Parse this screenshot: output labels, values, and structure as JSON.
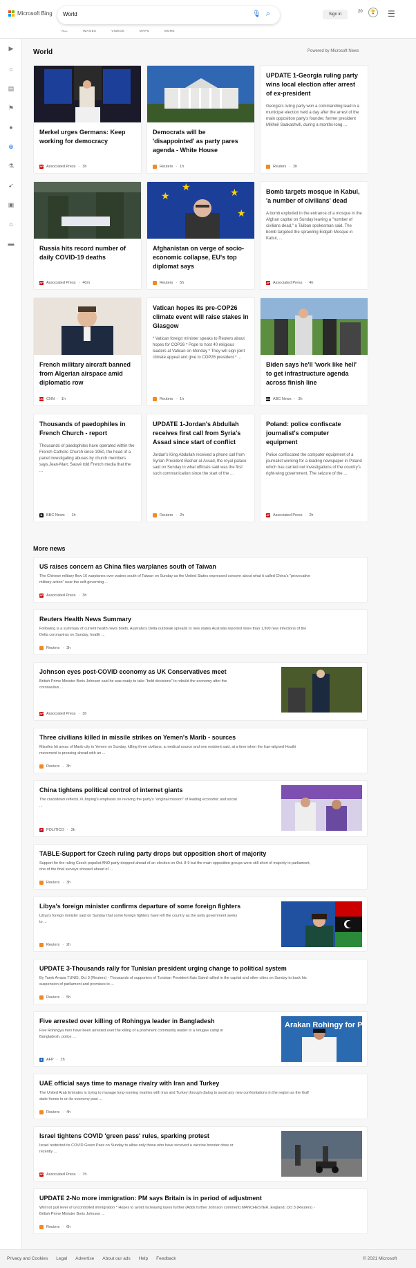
{
  "brand": "Microsoft Bing",
  "search": {
    "value": "World"
  },
  "nav": [
    "ALL",
    "IMAGES",
    "VIDEOS",
    "MAPS",
    "MORE"
  ],
  "header": {
    "signin": "Sign in",
    "rewards_count": "20"
  },
  "section": {
    "title": "World",
    "powered": "Powered by Microsoft News"
  },
  "cards": [
    {
      "title": "Merkel urges Germans: Keep working for democracy",
      "snippet": "",
      "source": "Associated Press",
      "time": "3h",
      "logo": "AP"
    },
    {
      "title": "Democrats will be 'disappointed' as party pares agenda - White House",
      "snippet": "",
      "source": "Reuters",
      "time": "1h",
      "logo": "R"
    },
    {
      "title": "UPDATE 1-Georgia ruling party wins local election after arrest of ex-president",
      "snippet": "Georgia's ruling party won a commanding lead in a municipal election held a day after the arrest of the main opposition party's founder, former president Mikheil Saakashvili, during a months-long ...",
      "source": "Reuters",
      "time": "2h",
      "logo": "R"
    },
    {
      "title": "Russia hits record number of daily COVID-19 deaths",
      "snippet": "",
      "source": "Associated Press",
      "time": "40m",
      "logo": "AP"
    },
    {
      "title": "Afghanistan on verge of socio-economic collapse, EU's top diplomat says",
      "snippet": "",
      "source": "Reuters",
      "time": "5h",
      "logo": "R"
    },
    {
      "title": "Bomb targets mosque in Kabul, 'a number of civilians' dead",
      "snippet": "A bomb exploded in the entrance of a mosque in the Afghan capital on Sunday leaving a \"number of civilians dead,\" a Taliban spokesman said. The bomb targeted the sprawling Eidgah Mosque in Kabul, ...",
      "source": "Associated Press",
      "time": "4h",
      "logo": "AP"
    },
    {
      "title": "French military aircraft banned from Algerian airspace amid diplomatic row",
      "snippet": "",
      "source": "CNN",
      "time": "1h",
      "logo": "CNN"
    },
    {
      "title": "Vatican hopes its pre-COP26 climate event will raise stakes in Glasgow",
      "snippet": "* Vatican foreign minister speaks to Reuters about hopes for COP26 * Pope to host 40 religious leaders at Vatican on Monday * They will sign joint climate appeal and give to COP26 president * ...",
      "source": "Reuters",
      "time": "1h",
      "logo": "R"
    },
    {
      "title": "Biden says he'll 'work like hell' to get infrastructure agenda across finish line",
      "snippet": "",
      "source": "ABC News",
      "time": "3h",
      "logo": "abc"
    },
    {
      "title": "Thousands of paedophiles in French Church - report",
      "snippet": "Thousands of paedophiles have operated within the French Catholic Church since 1950, the head of a panel investigating abuses by church members says.Jean-Marc Sauvé told French media that the ...",
      "source": "BBC News",
      "time": "1h",
      "logo": "BBC"
    },
    {
      "title": "UPDATE 1-Jordan's Abdullah receives first call from Syria's Assad since start of conflict",
      "snippet": "Jordan's King Abdullah received a phone call from Syrian President Bashar al-Assad, the royal palace said on Sunday in what officials said was the first such communication since the start of the ...",
      "source": "Reuters",
      "time": "2h",
      "logo": "R"
    },
    {
      "title": "Poland: police confiscate journalist's computer equipment",
      "snippet": "Police confiscated the computer equipment of a journalist working for a leading newspaper in Poland which has carried out investigations of the country's right-wing government. The seizure of the ...",
      "source": "Associated Press",
      "time": "2h",
      "logo": "AP"
    }
  ],
  "more_news": {
    "title": "More news",
    "items": [
      {
        "title": "US raises concern as China flies warplanes south of Taiwan",
        "snippet1": "The Chinese military flew 16 warplanes over waters south of Taiwan on Sunday as the United States expressed concern about what it called China's \"provocative",
        "snippet2": "military action\" near the self-governing ...",
        "source": "Associated Press",
        "time": "3h",
        "logo": "AP"
      },
      {
        "title": "Reuters Health News Summary",
        "snippet1": "Following is a summary of current health news briefs. Australia's Delta outbreak spreads to new states Australia reported more than 1,900 new infections of the",
        "snippet2": "Delta coronavirus on Sunday, health ...",
        "source": "Reuters",
        "time": "3h",
        "logo": "R"
      },
      {
        "title": "Johnson eyes post-COVID economy as UK Conservatives meet",
        "snippet1": "British Prime Minister Boris Johnson said he was ready to take \"bold decisions\" to rebuild the economy after the",
        "snippet2": "coronavirus ...",
        "source": "Associated Press",
        "time": "3h",
        "logo": "AP"
      },
      {
        "title": "Three civilians killed in missile strikes on Yemen's Marib - sources",
        "snippet1": "Missiles hit areas of Marib city in Yemen on Sunday, killing three civilians, a medical source and one resident said, at a time when the Iran-aligned Houthi",
        "snippet2": "movement is pressing ahead with an ...",
        "source": "Reuters",
        "time": "3h",
        "logo": "R"
      },
      {
        "title": "China tightens political control of internet giants",
        "snippet1": "The crackdown reflects Xi Jinping's emphasis on reviving the party's \"original mission\" of leading economic and social",
        "snippet2": "...",
        "source": "POLITICO",
        "time": "3h",
        "logo": "P"
      },
      {
        "title": "TABLE-Support for Czech ruling party drops but opposition short of majority",
        "snippet1": "Support for the ruling Czech populist ANO party dropped ahead of an election on Oct. 8-9 but the main opposition groups were still short of majority in parliament,",
        "snippet2": "one of the final surveys showed ahead of ...",
        "source": "Reuters",
        "time": "3h",
        "logo": "R"
      },
      {
        "title": "Libya's foreign minister confirms departure of some foreign fighters",
        "snippet1": "Libya's foreign minister said on Sunday that some foreign fighters have left the country as the unity government seeks",
        "snippet2": "to ...",
        "source": "Reuters",
        "time": "2h",
        "logo": "R"
      },
      {
        "title": "UPDATE 3-Thousands rally for Tunisian president urging change to political system",
        "snippet1": "By Tarek Amara TUNIS, Oct 3 (Reuters) - Thousands of supporters of Tunisian President Kais Saied rallied in the capital and other cities on Sunday to back his",
        "snippet2": "suspension of parliament and promises to ...",
        "source": "Reuters",
        "time": "5h",
        "logo": "R"
      },
      {
        "title": "Five arrested over killing of Rohingya leader in Bangladesh",
        "snippet1": "Five Rohingya men have been arrested over the killing of a prominent community leader in a refugee camp in",
        "snippet2": "Bangladesh, police ...",
        "source": "AFP",
        "time": "2h",
        "logo": "AFP"
      },
      {
        "title": "UAE official says time to manage rivalry with Iran and Turkey",
        "snippet1": "The United Arab Emirates is trying to manage long-running rivalries with Iran and Turkey through dialog to avoid any new confrontations in the region as the Gulf",
        "snippet2": "state hones in on its economy post ...",
        "source": "Reuters",
        "time": "4h",
        "logo": "R"
      },
      {
        "title": "Israel tightens COVID 'green pass' rules, sparking protest",
        "snippet1": "Israel restricted its COVID Green Pass on Sunday to allow only those who have received a vaccine booster dose or",
        "snippet2": "recently ...",
        "source": "Associated Press",
        "time": "7h",
        "logo": "AP"
      },
      {
        "title": "UPDATE 2-No more immigration: PM says Britain is in period of adjustment",
        "snippet1": "Will not pull lever of uncontrolled immigration * Hopes to avoid increasing taxes further (Adds further Johnson comment) MANCHESTER, England, Oct 3 (Reuters) -",
        "snippet2": "British Prime Minister Boris Johnson ...",
        "source": "Reuters",
        "time": "6h",
        "logo": "R"
      }
    ]
  },
  "image_text": {
    "rohingya_banner": "Arakan Rohingy for Peace & Hum"
  },
  "footer": {
    "links": [
      "Privacy and Cookies",
      "Legal",
      "Advertise",
      "About our ads",
      "Help",
      "Feedback"
    ],
    "copyright": "© 2021 Microsoft"
  },
  "colors": {
    "accent": "#1a73e8",
    "ap": "#cc0000",
    "reuters": "#f08a24",
    "cnn": "#cc0000",
    "abc": "#111111",
    "bbc": "#111111",
    "politico": "#c8102e",
    "afp": "#1c67b4"
  }
}
